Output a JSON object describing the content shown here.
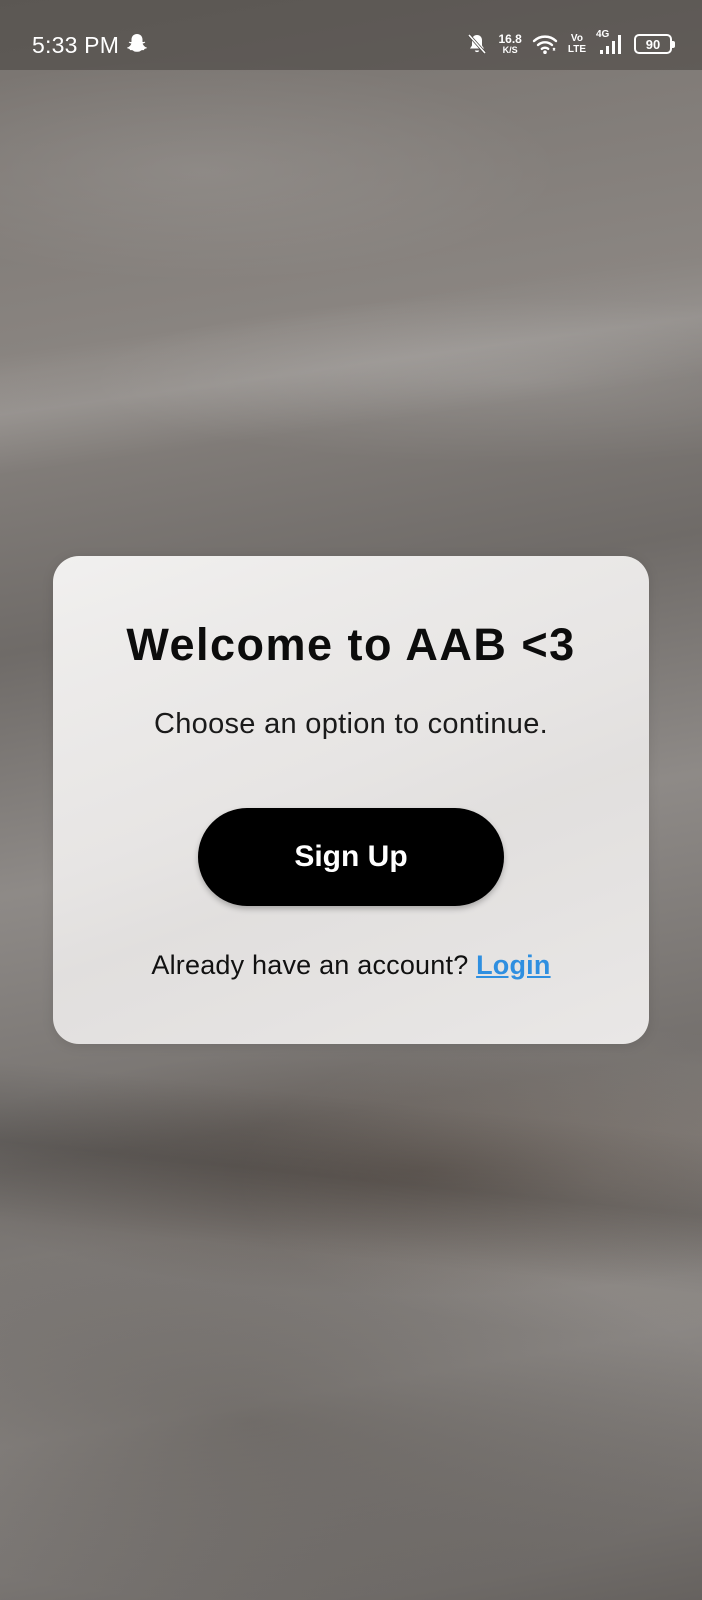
{
  "status_bar": {
    "time": "5:33 PM",
    "left_icon": "snapchat-ghost-icon",
    "network_speed_value": "16.8",
    "network_speed_unit": "K/S",
    "volte_top": "Vo",
    "volte_bottom": "LTE",
    "network_type": "4G",
    "battery_level": "90",
    "icons": [
      "notifications-muted-icon",
      "wifi-icon",
      "signal-icon",
      "battery-icon"
    ]
  },
  "dialog": {
    "title": "Welcome to AAB <3",
    "subtitle": "Choose an option to continue.",
    "signup_label": "Sign Up",
    "login_prompt": "Already have an account?",
    "login_label": "Login"
  },
  "colors": {
    "button_bg": "#000000",
    "button_text": "#ffffff",
    "link": "#2f8fe0",
    "card_bg": "#efeeed"
  }
}
